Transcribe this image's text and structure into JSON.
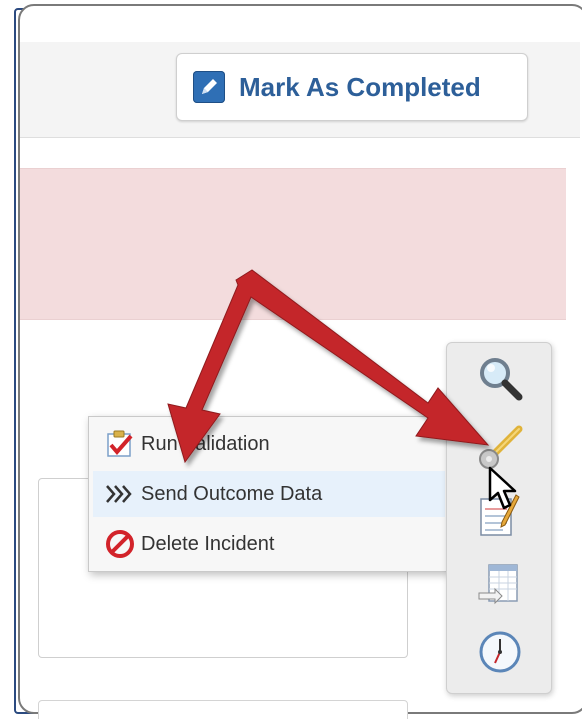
{
  "toolbar": {
    "mark_completed_label": "Mark As Completed"
  },
  "context_menu": {
    "items": [
      {
        "label": "Run Validation",
        "icon": "checklist-icon"
      },
      {
        "label": "Send Outcome Data",
        "icon": "chevrons-right-icon"
      },
      {
        "label": "Delete Incident",
        "icon": "no-entry-icon"
      }
    ]
  },
  "tools": [
    {
      "icon": "magnifier-icon"
    },
    {
      "icon": "wrench-icon"
    },
    {
      "icon": "notepad-pencil-icon"
    },
    {
      "icon": "spreadsheet-export-icon"
    },
    {
      "icon": "clock-icon"
    }
  ],
  "colors": {
    "frame_border": "#2b4a80",
    "alert_background": "#f3dcdd",
    "button_text": "#2d5f99",
    "annotation_arrow": "#c4262b"
  }
}
